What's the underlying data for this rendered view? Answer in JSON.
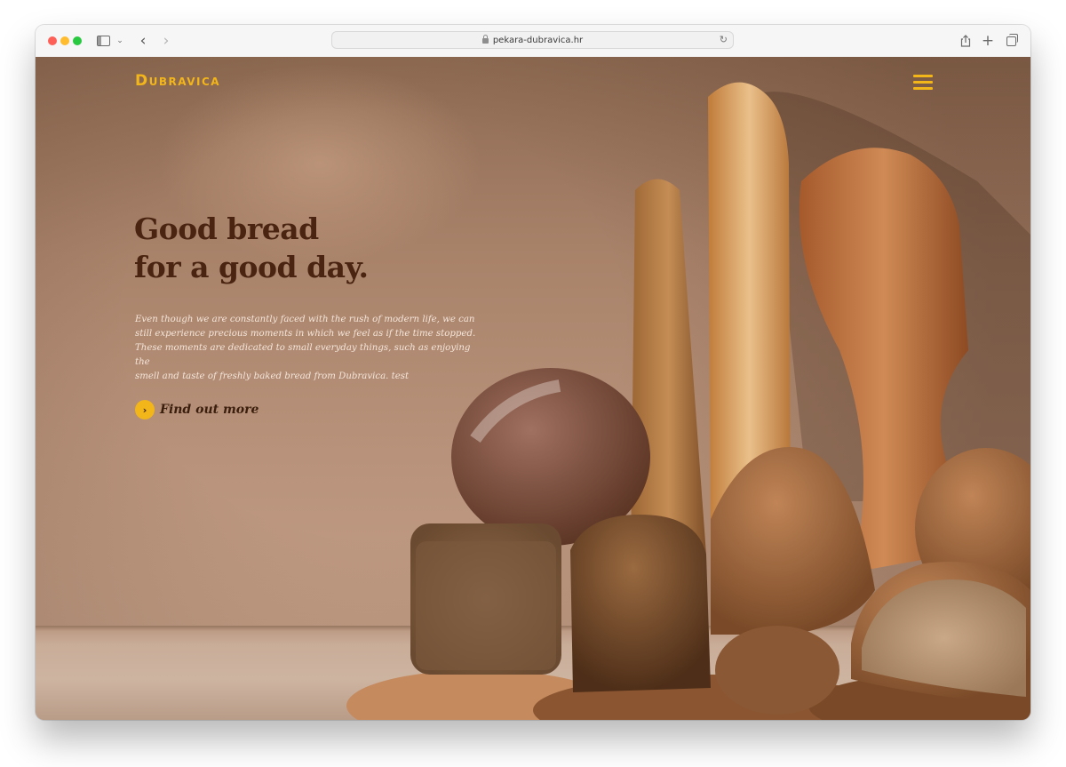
{
  "browser": {
    "url": "pekara-dubravica.hr",
    "controls": {
      "close": "close-window",
      "minimize": "minimize-window",
      "zoom": "zoom-window",
      "sidebar": "sidebar-icon",
      "back": "‹",
      "forward": "›",
      "reload": "↻",
      "share": "⇪",
      "new_tab": "+",
      "tab_overview": "tabs-icon"
    }
  },
  "site": {
    "logo": "Dubravica",
    "brand_color": "#f2b51a",
    "headline_line1": "Good bread",
    "headline_line2": "for a good day.",
    "intro_lines": [
      "Even though we are constantly faced with the rush of modern life, we can",
      "still experience precious moments in which we feel as if the time stopped.",
      "These moments are dedicated to small everyday things, such as enjoying the",
      "smell and taste of freshly baked bread from Dubravica. test"
    ],
    "cta_label": "Find out more",
    "cta_icon": "›",
    "hero_image": "assorted-breads-photo"
  }
}
